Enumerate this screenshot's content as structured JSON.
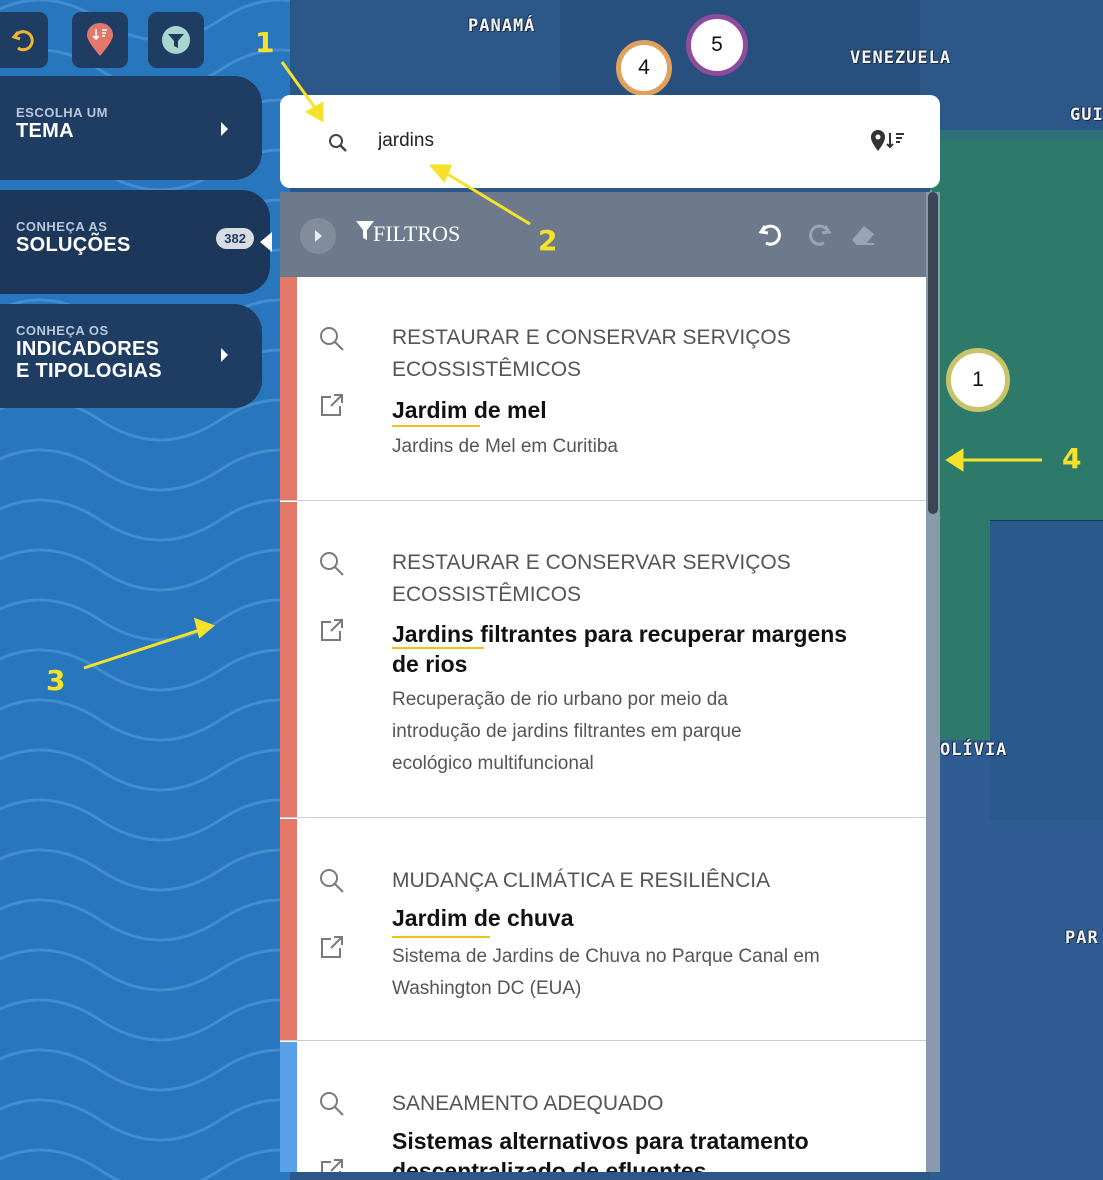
{
  "toolbar": {
    "reset_icon": "undo-icon",
    "pin_sort_icon": "map-pin-sort-icon",
    "filter_icon": "filter-icon"
  },
  "nav": {
    "tema": {
      "small": "ESCOLHA UM",
      "big": "TEMA"
    },
    "solucoes": {
      "small": "CONHEÇA AS",
      "big": "SOLUÇÕES",
      "badge": "382"
    },
    "indicadores": {
      "small": "CONHEÇA OS",
      "big1": "INDICADORES",
      "big2": "E TIPOLOGIAS"
    }
  },
  "search": {
    "value": "jardins",
    "placeholder": ""
  },
  "filters": {
    "label": "FILTROS"
  },
  "results": [
    {
      "category_lines": [
        "RESTAURAR E CONSERVAR SERVIÇOS",
        "ECOSSISTÊMICOS"
      ],
      "title_lines": [
        "Jardim de mel"
      ],
      "desc_lines": [
        "Jardins de Mel em Curitiba"
      ],
      "stripe_color": "#e2786a"
    },
    {
      "category_lines": [
        "RESTAURAR E CONSERVAR SERVIÇOS",
        "ECOSSISTÊMICOS"
      ],
      "title_lines": [
        "Jardins filtrantes para recuperar margens",
        "de rios"
      ],
      "desc_lines": [
        "Recuperação de rio urbano por meio da",
        "introdução de jardins filtrantes em parque",
        "ecológico multifuncional"
      ],
      "stripe_color": "#e2786a"
    },
    {
      "category_lines": [
        "MUDANÇA CLIMÁTICA E RESILIÊNCIA"
      ],
      "title_lines": [
        "Jardim de chuva"
      ],
      "desc_lines": [
        "Sistema de Jardins de Chuva no Parque Canal em",
        "Washington DC (EUA)"
      ],
      "stripe_color": "#e2786a"
    },
    {
      "category_lines": [
        "SANEAMENTO ADEQUADO"
      ],
      "title_lines": [
        "Sistemas alternativos para tratamento",
        "descentralizado de efluentes"
      ],
      "desc_lines": [],
      "stripe_color": "#5aa0e8"
    }
  ],
  "map": {
    "labels": {
      "panama": "PANAMÁ",
      "venezuela": "VENEZUELA",
      "guiana": "GUI",
      "bolivia": "OLÍVIA",
      "paraguai": "PAR"
    },
    "markers": [
      "4",
      "5",
      "1"
    ]
  },
  "annotations": [
    "1",
    "2",
    "3",
    "4"
  ]
}
